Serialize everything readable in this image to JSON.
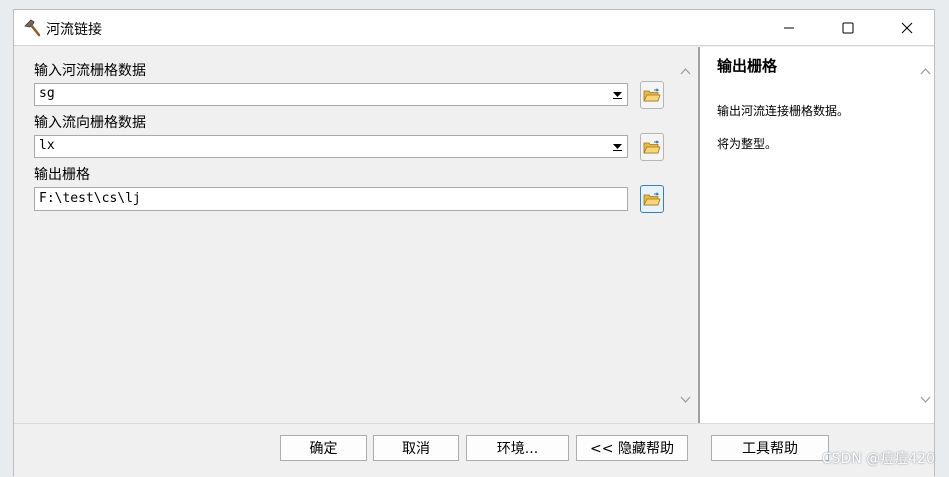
{
  "window": {
    "title": "河流链接",
    "app_icon": "hammer-icon",
    "controls": {
      "minimize": "minimize-icon",
      "maximize": "maximize-icon",
      "close": "close-icon"
    }
  },
  "form": {
    "fields": [
      {
        "label": "输入河流栅格数据",
        "value": "sg",
        "type": "combo"
      },
      {
        "label": "输入流向栅格数据",
        "value": "lx",
        "type": "combo"
      },
      {
        "label": "输出栅格",
        "value": "F:\\test\\cs\\lj",
        "type": "text"
      }
    ],
    "browse_icon": "open-folder-icon"
  },
  "help": {
    "title": "输出栅格",
    "lines": [
      "输出河流连接栅格数据。",
      "将为整型。"
    ]
  },
  "buttons": {
    "ok": "确定",
    "cancel": "取消",
    "environments": "环境...",
    "hide_help": "<< 隐藏帮助",
    "tool_help": "工具帮助"
  },
  "watermark": "CSDN @痘痘420"
}
